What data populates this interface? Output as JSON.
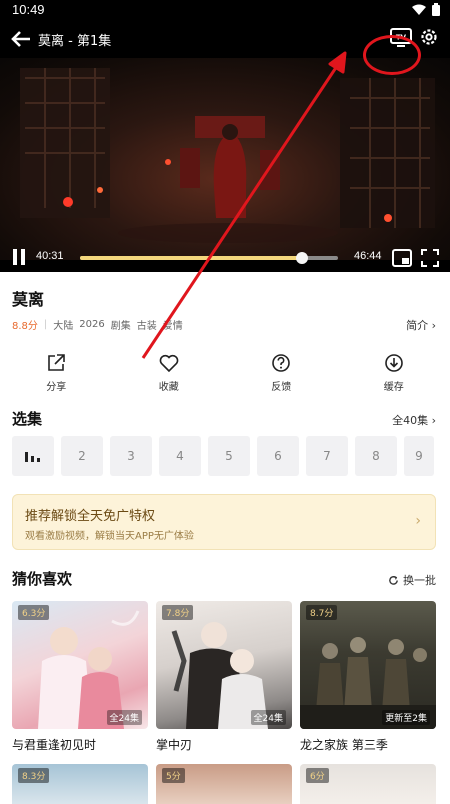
{
  "status_bar": {
    "time": "10:49"
  },
  "player": {
    "title": "莫离 - 第1集",
    "current_time": "40:31",
    "total_time": "46:44",
    "progress": 0.86
  },
  "show": {
    "title": "莫离",
    "score": "8.8分",
    "tags": [
      "大陆",
      "2026",
      "剧集",
      "古装",
      "爱情"
    ],
    "intro_label": "简介"
  },
  "actions": [
    {
      "label": "分享",
      "icon": "share-icon"
    },
    {
      "label": "收藏",
      "icon": "heart-icon"
    },
    {
      "label": "反馈",
      "icon": "question-icon"
    },
    {
      "label": "缓存",
      "icon": "download-icon"
    }
  ],
  "episodes": {
    "title": "选集",
    "all_label": "全40集",
    "items": [
      "2",
      "3",
      "4",
      "5",
      "6",
      "7",
      "8",
      "9"
    ]
  },
  "promo": {
    "title": "推荐解锁全天免广特权",
    "subtitle": "观看激励视频，解锁当天APP无广体验"
  },
  "recommend": {
    "title": "猜你喜欢",
    "refresh_label": "换一批",
    "cards": [
      {
        "name": "与君重逢初见时",
        "score": "6.3分",
        "badge": "全24集"
      },
      {
        "name": "掌中刃",
        "score": "7.8分",
        "badge": "全24集"
      },
      {
        "name": "龙之家族 第三季",
        "score": "8.7分",
        "badge": "更新至2集"
      }
    ],
    "next_scores": [
      "8.3分",
      "5分",
      "6分"
    ]
  },
  "colors": {
    "accent": "#e86a2e",
    "annotation": "#e0161d",
    "progress": "#f3d77d"
  }
}
